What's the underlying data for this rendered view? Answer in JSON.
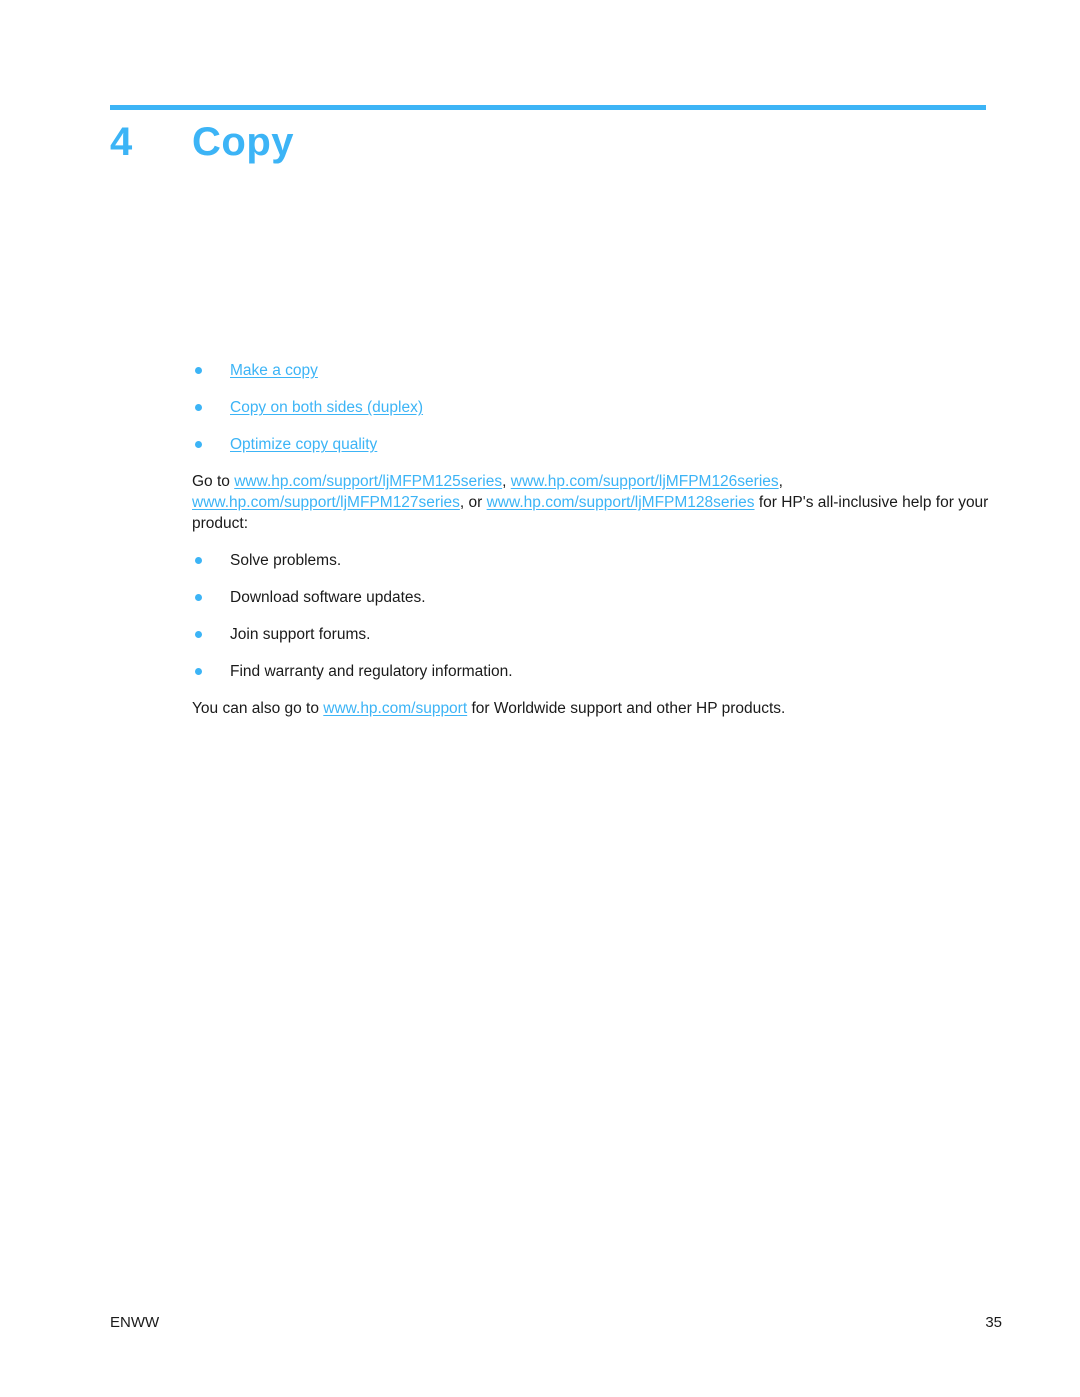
{
  "chapter": {
    "number": "4",
    "title": "Copy"
  },
  "toc_links": [
    {
      "label": "Make a copy"
    },
    {
      "label": "Copy on both sides (duplex)"
    },
    {
      "label": "Optimize copy quality"
    }
  ],
  "intro": {
    "prefix": "Go to ",
    "link1": "www.hp.com/support/ljMFPM125series",
    "sep1": ", ",
    "link2": "www.hp.com/support/ljMFPM126series",
    "sep2": ", ",
    "link3": "www.hp.com/support/ljMFPM127series",
    "sep3": ", or ",
    "link4": "www.hp.com/support/ljMFPM128series",
    "suffix": " for HP's all-inclusive help for your product:"
  },
  "help_items": [
    {
      "label": "Solve problems."
    },
    {
      "label": "Download software updates."
    },
    {
      "label": "Join support forums."
    },
    {
      "label": "Find warranty and regulatory information."
    }
  ],
  "closing": {
    "prefix": "You can also go to ",
    "link": "www.hp.com/support",
    "suffix": " for Worldwide support and other HP products."
  },
  "footer": {
    "left": "ENWW",
    "page_number": "35"
  },
  "colors": {
    "accent": "#3cb4f6",
    "text": "#1a1a1a"
  }
}
